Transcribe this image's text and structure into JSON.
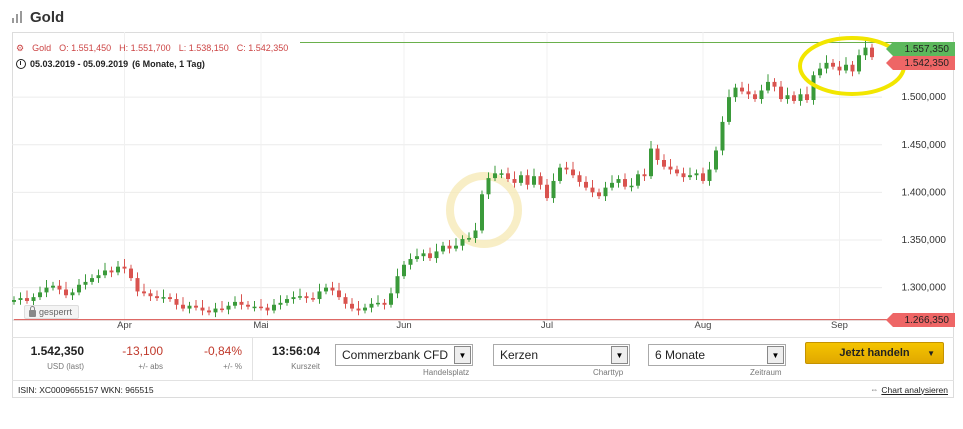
{
  "header": {
    "title": "Gold"
  },
  "legend": {
    "name": "Gold",
    "open": "O: 1.551,450",
    "high": "H: 1.551,700",
    "low": "L: 1.538,150",
    "close": "C: 1.542,350",
    "range": "05.03.2019 - 05.09.2019",
    "period": "(6 Monate, 1 Tag)"
  },
  "badges": {
    "locked": "gesperrt"
  },
  "price_tags": {
    "high": "1.557,350",
    "last": "1.542,350",
    "low": "1.266,350"
  },
  "stats": {
    "last": {
      "value": "1.542,350",
      "label": "USD (last)"
    },
    "abs": {
      "value": "-13,100",
      "label": "+/- abs"
    },
    "pct": {
      "value": "-0,84%",
      "label": "+/- %"
    },
    "time": {
      "value": "13:56:04",
      "label": "Kurszeit"
    }
  },
  "selects": {
    "venue": {
      "value": "Commerzbank CFD",
      "label": "Handelsplatz"
    },
    "chart_type": {
      "value": "Kerzen",
      "label": "Charttyp"
    },
    "period": {
      "value": "6 Monate",
      "label": "Zeitraum"
    }
  },
  "trade_button": "Jetzt handeln",
  "footer": {
    "isin": "ISIN: XC0009655157 WKN: 965515",
    "analyze": "Chart analysieren"
  },
  "colors": {
    "up": "#3a9a3a",
    "down": "#d9534f",
    "highlight": "#f2e600",
    "hline_high": "#6ab04c",
    "hline_low": "#d9534f"
  },
  "chart_data": {
    "type": "candlestick",
    "x": [
      "Apr",
      "Mai",
      "Jun",
      "Jul",
      "Aug",
      "Sep"
    ],
    "ylim": [
      1266,
      1560
    ],
    "yticks": [
      "1.300,000",
      "1.350,000",
      "1.400,000",
      "1.450,000",
      "1.500,000"
    ],
    "ytick_values": [
      1300,
      1350,
      1400,
      1450,
      1500
    ],
    "close_series": [
      1287,
      1289,
      1286,
      1290,
      1295,
      1300,
      1302,
      1298,
      1292,
      1295,
      1303,
      1306,
      1310,
      1313,
      1318,
      1316,
      1322,
      1320,
      1310,
      1296,
      1294,
      1291,
      1289,
      1290,
      1288,
      1282,
      1278,
      1281,
      1279,
      1276,
      1274,
      1278,
      1277,
      1281,
      1285,
      1282,
      1280,
      1280,
      1279,
      1276,
      1282,
      1284,
      1288,
      1290,
      1291,
      1289,
      1288,
      1296,
      1300,
      1297,
      1290,
      1283,
      1278,
      1276,
      1279,
      1283,
      1284,
      1282,
      1294,
      1312,
      1324,
      1330,
      1333,
      1336,
      1331,
      1338,
      1344,
      1341,
      1344,
      1351,
      1352,
      1360,
      1398,
      1415,
      1420,
      1420,
      1414,
      1410,
      1418,
      1408,
      1417,
      1408,
      1394,
      1412,
      1426,
      1424,
      1418,
      1411,
      1405,
      1400,
      1396,
      1405,
      1410,
      1414,
      1406,
      1407,
      1419,
      1417,
      1446,
      1434,
      1427,
      1424,
      1420,
      1416,
      1418,
      1420,
      1412,
      1424,
      1444,
      1474,
      1500,
      1510,
      1506,
      1503,
      1498,
      1507,
      1516,
      1511,
      1498,
      1502,
      1496,
      1503,
      1497,
      1523,
      1530,
      1536,
      1532,
      1528,
      1534,
      1527,
      1544,
      1552,
      1542
    ]
  }
}
